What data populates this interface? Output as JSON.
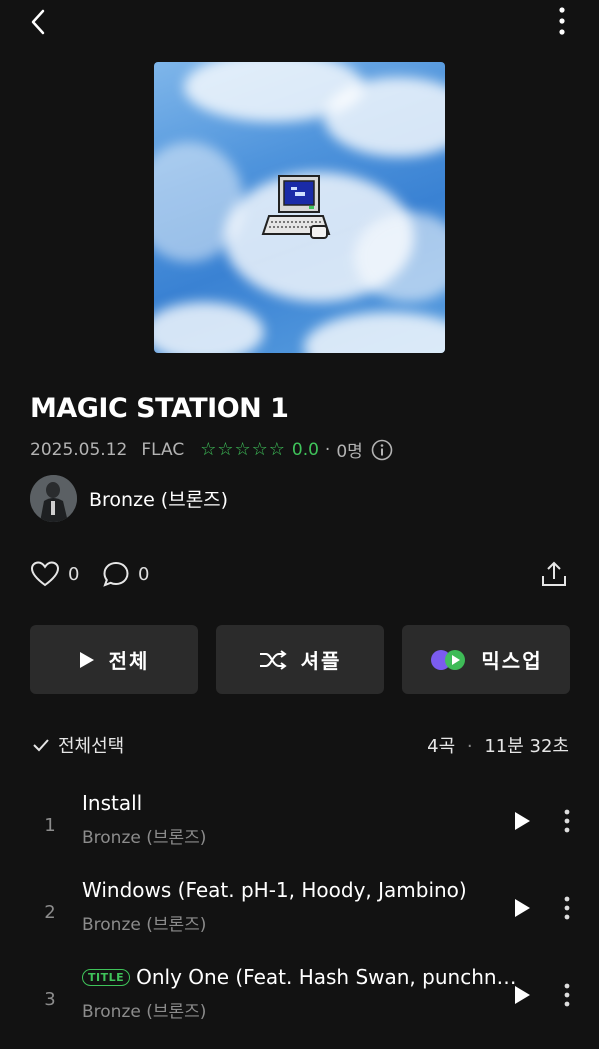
{
  "header": {
    "back_icon": "chevron-left-icon",
    "more_icon": "vertical-dots-icon"
  },
  "album": {
    "title": "MAGIC STATION 1",
    "date": "2025.05.12",
    "format": "FLAC",
    "rating_stars": "☆☆☆☆☆",
    "rating_score": "0.0",
    "rating_sep": "·",
    "rating_count": "0명",
    "accent_color": "#3fc35a"
  },
  "artist": {
    "name": "Bronze (브론즈)"
  },
  "social": {
    "likes": "0",
    "comments": "0"
  },
  "actions": {
    "play_all": "전체",
    "shuffle": "셔플",
    "mixup": "믹스업"
  },
  "list": {
    "select_all": "전체선택",
    "summary_count": "4곡",
    "summary_sep": "·",
    "summary_duration": "11분 32초"
  },
  "tracks": [
    {
      "number": "1",
      "title": "Install",
      "artist": "Bronze (브론즈)",
      "badge": ""
    },
    {
      "number": "2",
      "title": "Windows (Feat. pH-1, Hoody, Jambino)",
      "artist": "Bronze (브론즈)",
      "badge": ""
    },
    {
      "number": "3",
      "title": "Only One (Feat. Hash Swan, punchn…",
      "artist": "Bronze (브론즈)",
      "badge": "TITLE"
    }
  ]
}
